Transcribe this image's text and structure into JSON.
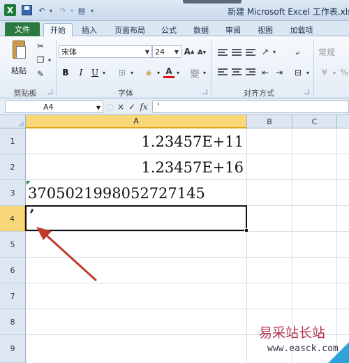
{
  "window": {
    "title": "新建 Microsoft Excel 工作表.xls",
    "app_logo": "X"
  },
  "ribbon_tabs": [
    "开始",
    "插入",
    "页面布局",
    "公式",
    "数据",
    "审阅",
    "视图",
    "加载项"
  ],
  "file_tab": "文件",
  "active_tab": "开始",
  "ribbon": {
    "clipboard": {
      "paste_label": "粘贴",
      "group_label": "剪贴板"
    },
    "font": {
      "font_name": "宋体",
      "font_size": "24",
      "bold": "B",
      "italic": "I",
      "underline": "U",
      "font_color_glyph": "A",
      "wen_glyph": "變",
      "group_label": "字体"
    },
    "alignment": {
      "group_label": "对齐方式"
    },
    "number": {
      "format": "常规"
    }
  },
  "formula_bar": {
    "name_box": "A4",
    "cancel": "×",
    "enter": "✓",
    "fx": "fx",
    "content": "’"
  },
  "sheet": {
    "columns": [
      "A",
      "B",
      "C"
    ],
    "rows": [
      "1",
      "2",
      "3",
      "4",
      "5",
      "6",
      "7",
      "8",
      "9"
    ],
    "selected_cell": "A4",
    "cells": {
      "A1": "1.23457E+11",
      "A2": "1.23457E+16",
      "A3": "3705021998052727145",
      "A4": "’"
    }
  },
  "watermark": {
    "line1": "易采站长站",
    "line2": "www.easck.com"
  },
  "colors": {
    "excel_green": "#2b7a3f",
    "selection": "#f8d778",
    "arrow": "#c0392b"
  },
  "icons": [
    "excel-logo-icon",
    "save-icon",
    "undo-icon",
    "redo-icon",
    "paste-icon",
    "cut-icon",
    "copy-icon",
    "format-painter-icon",
    "dialog-launcher-icon",
    "arrow-annotation-icon"
  ]
}
